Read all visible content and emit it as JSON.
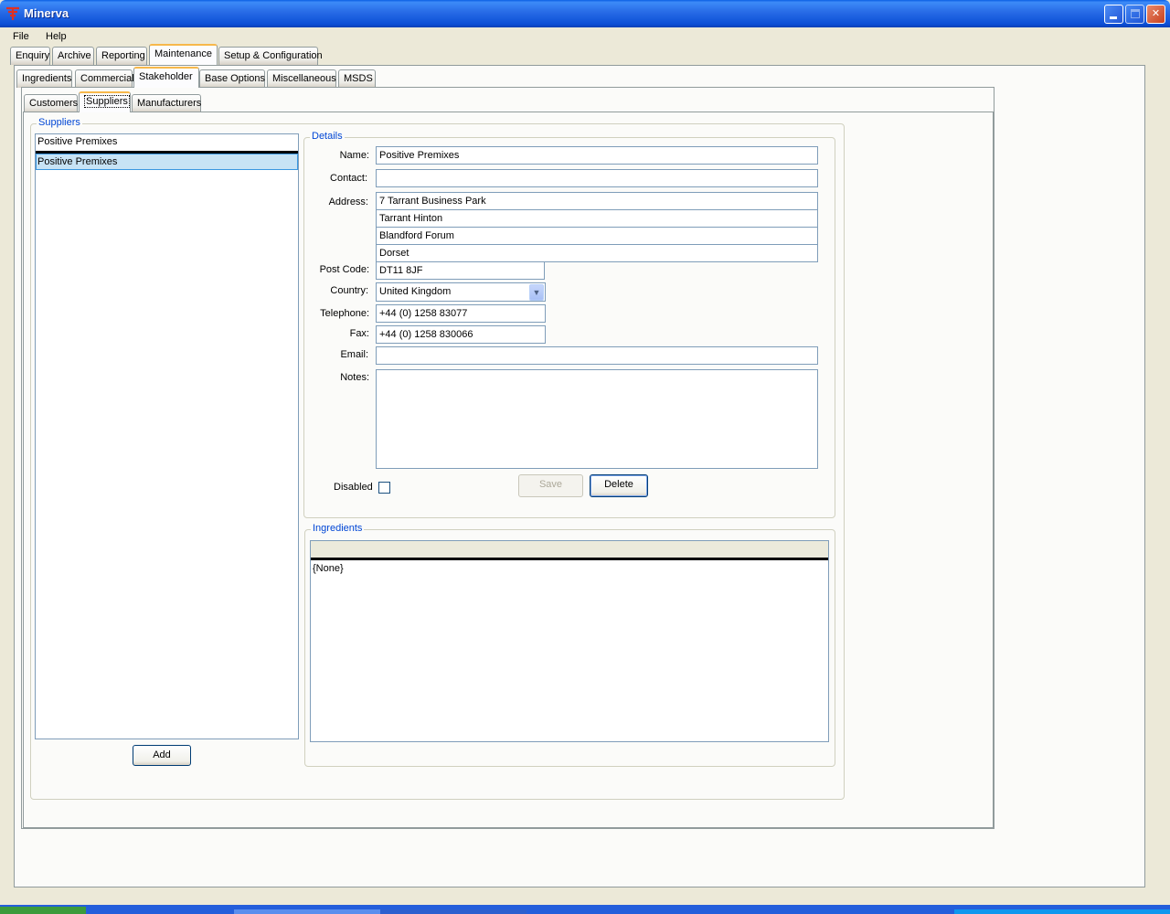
{
  "window": {
    "title": "Minerva"
  },
  "menu": [
    "File",
    "Help"
  ],
  "main_tabs": [
    "Enquiry",
    "Archive",
    "Reporting",
    "Maintenance",
    "Setup & Configuration"
  ],
  "maintenance_tabs": [
    "Ingredients",
    "Commercial",
    "Stakeholder",
    "Base Options",
    "Miscellaneous",
    "MSDS"
  ],
  "stakeholder_tabs": [
    "Customers",
    "Suppliers",
    "Manufacturers"
  ],
  "suppliers": {
    "group_label": "Suppliers",
    "header_item": "Positive Premixes",
    "items": [
      "Positive Premixes"
    ],
    "add_label": "Add"
  },
  "details": {
    "group_label": "Details",
    "labels": {
      "name": "Name:",
      "contact": "Contact:",
      "address": "Address:",
      "postcode": "Post Code:",
      "country": "Country:",
      "telephone": "Telephone:",
      "fax": "Fax:",
      "email": "Email:",
      "notes": "Notes:",
      "disabled": "Disabled"
    },
    "values": {
      "name": "Positive Premixes",
      "contact": "",
      "address1": "7 Tarrant Business Park",
      "address2": "Tarrant Hinton",
      "address3": "Blandford Forum",
      "address4": "Dorset",
      "postcode": "DT11 8JF",
      "country": "United Kingdom",
      "telephone": "+44 (0) 1258 83077",
      "fax": "+44 (0) 1258 830066",
      "email": "",
      "notes": ""
    },
    "save_label": "Save",
    "delete_label": "Delete"
  },
  "ingredients": {
    "group_label": "Ingredients",
    "empty_text": "{None}"
  }
}
